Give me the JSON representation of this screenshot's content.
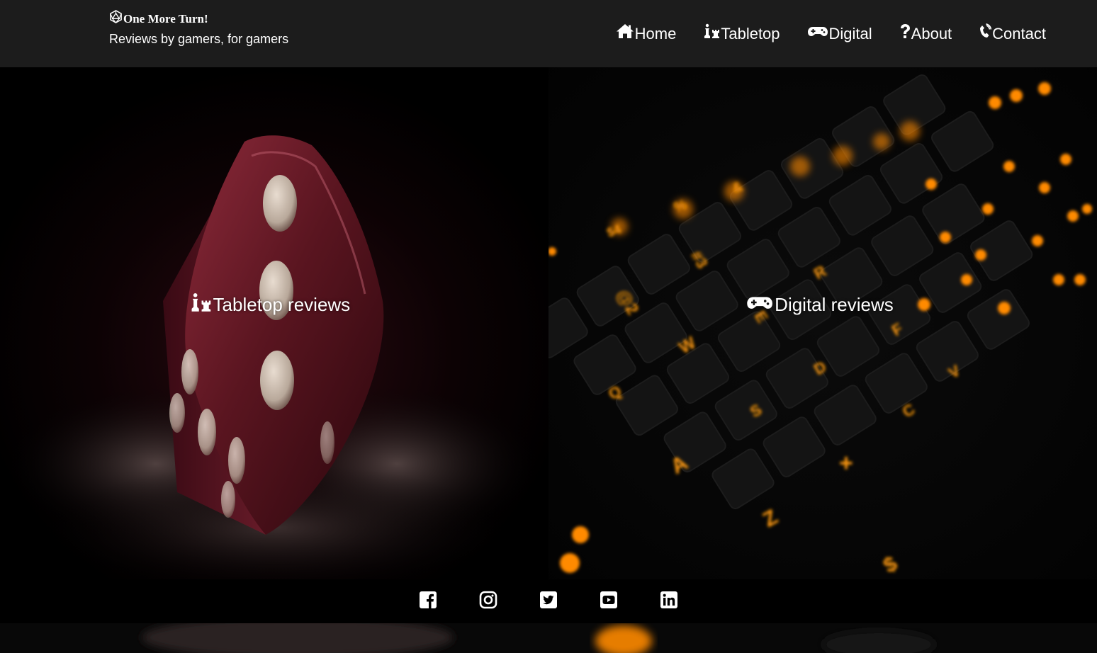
{
  "header": {
    "brand_title": "One More Turn!",
    "brand_tagline": "Reviews by gamers, for gamers",
    "logo_icon": "d20-dice-icon",
    "nav": [
      {
        "label": "Home",
        "icon": "home-icon"
      },
      {
        "label": "Tabletop",
        "icon": "chess-pieces-icon"
      },
      {
        "label": "Digital",
        "icon": "gamepad-icon"
      },
      {
        "label": "About",
        "icon": "question-icon"
      },
      {
        "label": "Contact",
        "icon": "phone-icon"
      }
    ]
  },
  "hero": {
    "tabletop_label": "Tabletop reviews",
    "digital_label": "Digital reviews"
  },
  "footer": {
    "social": [
      {
        "name": "facebook",
        "icon": "facebook-icon"
      },
      {
        "name": "instagram",
        "icon": "instagram-icon"
      },
      {
        "name": "twitter",
        "icon": "twitter-icon"
      },
      {
        "name": "youtube",
        "icon": "youtube-icon"
      },
      {
        "name": "linkedin",
        "icon": "linkedin-icon"
      }
    ]
  },
  "colors": {
    "header_bg": "#1c1c1c",
    "text": "#ffffff",
    "dice_red": "#6e1f2c",
    "key_glow": "#ff8a00"
  }
}
